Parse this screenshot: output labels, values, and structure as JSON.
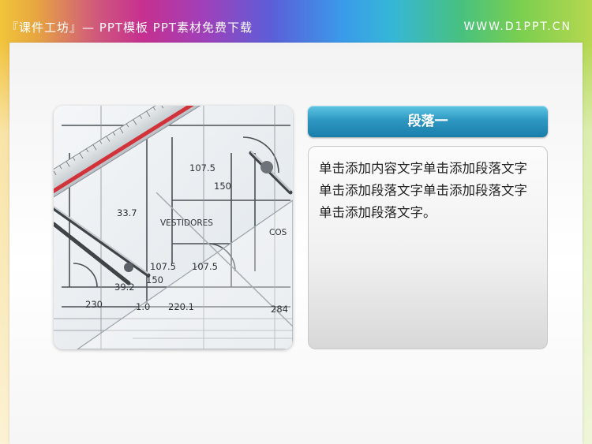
{
  "header": {
    "left_text": "『课件工坊』— PPT模板 PPT素材免费下载",
    "right_text": "WWW.D1PPT.CN"
  },
  "photo": {
    "label_vestidores": "VESTIDORES",
    "label_cos": "COS",
    "dim_1075_top": "107.5",
    "dim_150_top": "150",
    "dim_1075_a": "107.5",
    "dim_1075_b": "107.5",
    "dim_150_bottom": "150",
    "dim_392": "39.2",
    "dim_230": "230",
    "dim_10": "1.0",
    "dim_2201": "220.1",
    "dim_284": "284",
    "dim_337": "33.7"
  },
  "panel": {
    "title": "段落一",
    "body": "单击添加内容文字单击添加段落文字单击添加段落文字单击添加段落文字单击添加段落文字。"
  }
}
